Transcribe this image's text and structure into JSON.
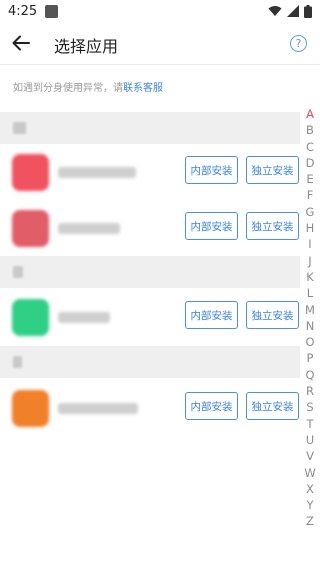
{
  "status_bar": {
    "time": "4:25"
  },
  "toolbar": {
    "title": "选择应用",
    "help_label": "?"
  },
  "hint": {
    "text": "如遇到分身使用异常，请",
    "link": "联系客服"
  },
  "apps": [
    {
      "icon_color": "#f0525f",
      "install_internal": "内部安装",
      "install_standalone": "独立安装"
    },
    {
      "icon_color": "#e15d68",
      "install_internal": "内部安装",
      "install_standalone": "独立安装"
    },
    {
      "icon_color": "#2fcf86",
      "install_internal": "内部安装",
      "install_standalone": "独立安装"
    },
    {
      "icon_color": "#f0802a",
      "install_internal": "内部安装",
      "install_standalone": "独立安装"
    }
  ],
  "index_letters": [
    "A",
    "B",
    "C",
    "D",
    "E",
    "F",
    "G",
    "H",
    "I",
    "J",
    "K",
    "L",
    "M",
    "N",
    "O",
    "P",
    "Q",
    "R",
    "S",
    "T",
    "U",
    "V",
    "W",
    "X",
    "Y",
    "Z"
  ],
  "active_letter": "A",
  "colors": {
    "accent": "#3a84dd",
    "index_active": "#e94b4b",
    "section_bg": "#efefef"
  }
}
